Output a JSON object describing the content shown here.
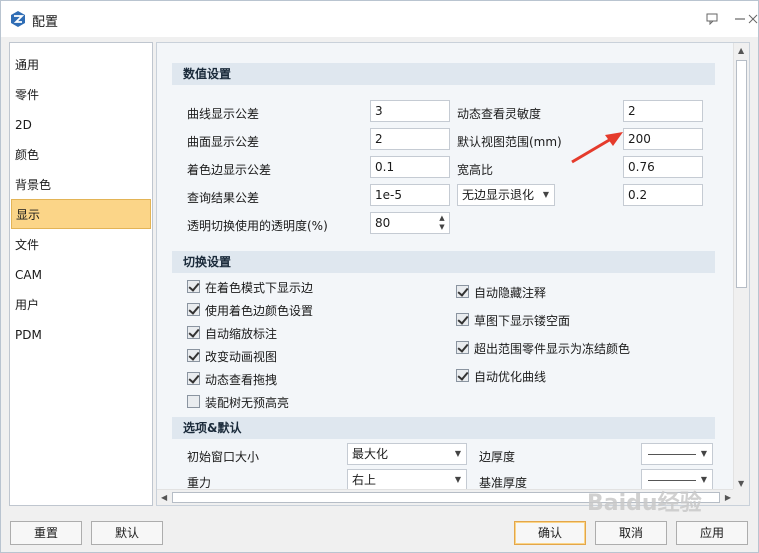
{
  "window": {
    "title": "配置"
  },
  "colors": {
    "accent": "#fbd588",
    "arrow": "#e53b2c"
  },
  "titlebar_icons": [
    "help-icon",
    "minimize-icon",
    "close-icon"
  ],
  "sidebar": {
    "items": [
      {
        "label": "通用"
      },
      {
        "label": "零件"
      },
      {
        "label": "2D"
      },
      {
        "label": "颜色"
      },
      {
        "label": "背景色"
      },
      {
        "label": "显示",
        "active": true
      },
      {
        "label": "文件"
      },
      {
        "label": "CAM"
      },
      {
        "label": "用户"
      },
      {
        "label": "PDM"
      }
    ]
  },
  "numeric": {
    "header": "数值设置",
    "curve_tol": {
      "label": "曲线显示公差",
      "value": "3"
    },
    "surface_tol": {
      "label": "曲面显示公差",
      "value": "2"
    },
    "shade_edge_tol": {
      "label": "着色边显示公差",
      "value": "0.1"
    },
    "query_tol": {
      "label": "查询结果公差",
      "value": "1e-5"
    },
    "transparency": {
      "label": "透明切换使用的透明度(%)",
      "value": "80"
    },
    "dyn_sensitivity": {
      "label": "动态查看灵敏度",
      "value": "2"
    },
    "default_range": {
      "label": "默认视图范围(mm)",
      "value": "200"
    },
    "aspect": {
      "label": "宽高比",
      "value": "0.76"
    },
    "edge_fallback": {
      "selected": "无边显示退化",
      "value": "0.2"
    }
  },
  "switch": {
    "header": "切换设置",
    "left": [
      {
        "label": "在着色模式下显示边",
        "checked": true
      },
      {
        "label": "使用着色边颜色设置",
        "checked": true
      },
      {
        "label": "自动缩放标注",
        "checked": true
      },
      {
        "label": "改变动画视图",
        "checked": true
      },
      {
        "label": "动态查看拖拽",
        "checked": true
      },
      {
        "label": "装配树无预高亮",
        "checked": false
      }
    ],
    "right": [
      {
        "label": "自动隐藏注释",
        "checked": true
      },
      {
        "label": "草图下显示镂空面",
        "checked": true
      },
      {
        "label": "超出范围零件显示为冻结颜色",
        "checked": true
      },
      {
        "label": "自动优化曲线",
        "checked": true
      }
    ]
  },
  "options": {
    "header": "选项&默认",
    "init_window": {
      "label": "初始窗口大小",
      "selected": "最大化"
    },
    "gravity": {
      "label": "重力",
      "selected": "右上"
    },
    "edge_thickness": {
      "label": "边厚度"
    },
    "base_thickness": {
      "label": "基准厚度"
    }
  },
  "buttons": {
    "reset": "重置",
    "default": "默认",
    "ok": "确认",
    "cancel": "取消",
    "apply": "应用"
  },
  "watermark": "Baidu经验"
}
